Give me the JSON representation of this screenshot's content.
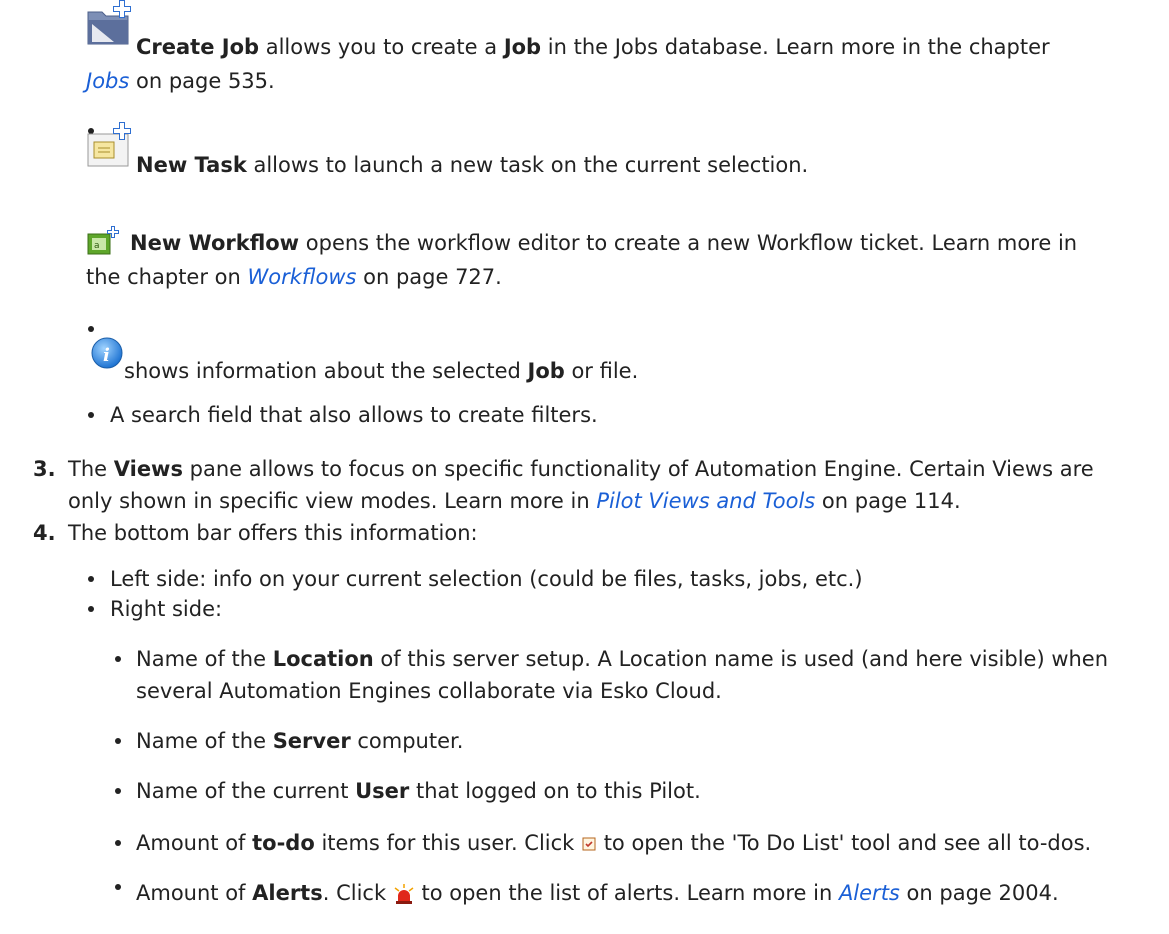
{
  "colors": {
    "link": "#1a5fd6",
    "text": "#222222",
    "folder": "#6b7ea8"
  },
  "items": {
    "create_job": {
      "icon": "folder-plus-icon",
      "bold": "Create Job",
      "text1": " allows you to create a ",
      "bold2": "Job",
      "text2": " in the Jobs database. Learn more in the chapter",
      "link": "Jobs",
      "text3": " on page 535."
    },
    "new_task": {
      "icon": "task-plus-icon",
      "bold": "New Task",
      "text1": " allows to launch a new task on the current selection."
    },
    "new_workflow": {
      "icon": "workflow-plus-icon",
      "bold": "New Workflow",
      "text1": " opens the workflow editor to create a new Workflow ticket. Learn more in",
      "text2": "the chapter on ",
      "link": "Workflows",
      "text3": " on page 727."
    },
    "info": {
      "icon": "info-icon",
      "text1": " shows information about the selected ",
      "bold": "Job",
      "text2": " or file."
    },
    "search": {
      "text": "A search field that also allows to create filters."
    }
  },
  "step3": {
    "number": "3.",
    "text1": "The ",
    "bold": "Views",
    "text2": " pane allows to focus on specific functionality of Automation Engine. Certain Views are",
    "text3": "only shown in specific view modes. Learn more in ",
    "link": "Pilot Views and Tools",
    "text4": "  on page 114."
  },
  "step4": {
    "number": "4.",
    "text": "The bottom bar offers this information:",
    "left": "Left side: info on your current selection (could be files, tasks, jobs, etc.)",
    "right": "Right side:",
    "location": {
      "text1": "Name of the ",
      "bold": "Location",
      "text2": " of this server setup. A Location name is used (and here visible) when",
      "text3": "several Automation Engines collaborate via Esko Cloud."
    },
    "server": {
      "text1": "Name of the ",
      "bold": "Server",
      "text2": " computer."
    },
    "user": {
      "text1": "Name of the current ",
      "bold": "User",
      "text2": " that logged on to this Pilot."
    },
    "todo": {
      "text1": "Amount of ",
      "bold": "to-do",
      "text2": " items for this user. Click ",
      "icon": "todo-icon",
      "text3": " to open the 'To Do List' tool and see all to-dos."
    },
    "alerts": {
      "text1": "Amount of ",
      "bold": "Alerts",
      "text2": ". Click ",
      "icon": "alarm-icon",
      "text3": " to open the list of alerts. Learn more in ",
      "link": "Alerts",
      "text4": " on page 2004."
    }
  }
}
